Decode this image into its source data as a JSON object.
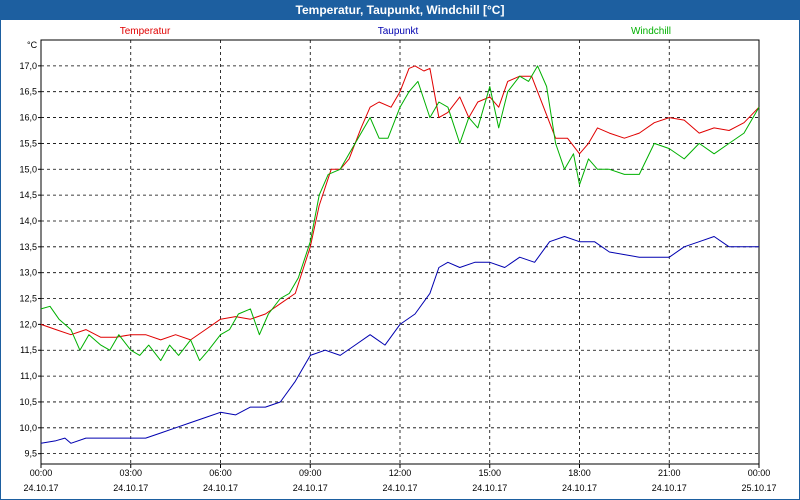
{
  "window": {
    "title": "Temperatur, Taupunkt, Windchill [°C]"
  },
  "chart_data": {
    "type": "line",
    "title": "Temperatur, Taupunkt, Windchill [°C]",
    "ylabel": "°C",
    "ylim": [
      9.3,
      17.5
    ],
    "y_ticks": [
      "9,5",
      "10,0",
      "10,5",
      "11,0",
      "11,5",
      "12,0",
      "12,5",
      "13,0",
      "13,5",
      "14,0",
      "14,5",
      "15,0",
      "15,5",
      "16,0",
      "16,5",
      "17,0"
    ],
    "x_ticks": [
      {
        "time": "00:00",
        "date": "24.10.17"
      },
      {
        "time": "03:00",
        "date": "24.10.17"
      },
      {
        "time": "06:00",
        "date": "24.10.17"
      },
      {
        "time": "09:00",
        "date": "24.10.17"
      },
      {
        "time": "12:00",
        "date": "24.10.17"
      },
      {
        "time": "15:00",
        "date": "24.10.17"
      },
      {
        "time": "18:00",
        "date": "24.10.17"
      },
      {
        "time": "21:00",
        "date": "24.10.17"
      },
      {
        "time": "00:00",
        "date": "25.10.17"
      }
    ],
    "xlim_hours": [
      0,
      24
    ],
    "grid": true,
    "series": [
      {
        "name": "Temperatur",
        "color": "#e00000",
        "x": [
          0,
          0.5,
          1,
          1.5,
          2,
          2.5,
          3,
          3.5,
          4,
          4.5,
          5,
          5.5,
          6,
          6.5,
          7,
          7.5,
          8,
          8.5,
          9,
          9.3,
          9.7,
          10,
          10.3,
          10.7,
          11,
          11.3,
          11.7,
          12,
          12.3,
          12.5,
          12.8,
          13,
          13.3,
          13.6,
          14,
          14.3,
          14.6,
          15,
          15.3,
          15.6,
          16,
          16.4,
          16.8,
          17.2,
          17.6,
          18,
          18.3,
          18.6,
          19,
          19.5,
          20,
          20.5,
          21,
          21.5,
          22,
          22.5,
          23,
          23.5,
          24
        ],
        "values": [
          12.0,
          11.9,
          11.8,
          11.9,
          11.75,
          11.75,
          11.8,
          11.8,
          11.7,
          11.8,
          11.7,
          11.9,
          12.1,
          12.15,
          12.1,
          12.2,
          12.4,
          12.6,
          13.5,
          14.3,
          15.0,
          15.0,
          15.2,
          15.8,
          16.2,
          16.3,
          16.2,
          16.5,
          16.95,
          17.0,
          16.9,
          16.95,
          16.0,
          16.1,
          16.4,
          16.0,
          16.3,
          16.4,
          16.2,
          16.7,
          16.8,
          16.8,
          16.2,
          15.6,
          15.6,
          15.3,
          15.5,
          15.8,
          15.7,
          15.6,
          15.7,
          15.9,
          16.0,
          15.95,
          15.7,
          15.8,
          15.75,
          15.9,
          16.2
        ]
      },
      {
        "name": "Taupunkt",
        "color": "#0000b0",
        "x": [
          0,
          0.5,
          0.8,
          1,
          1.5,
          2,
          2.5,
          3,
          3.5,
          4,
          4.5,
          5,
          5.5,
          6,
          6.5,
          7,
          7.5,
          8,
          8.5,
          9,
          9.5,
          10,
          10.5,
          11,
          11.5,
          12,
          12.5,
          13,
          13.3,
          13.6,
          14,
          14.5,
          15,
          15.5,
          16,
          16.5,
          17,
          17.5,
          18,
          18.5,
          19,
          19.5,
          20,
          20.5,
          21,
          21.5,
          22,
          22.5,
          23,
          23.5,
          24
        ],
        "values": [
          9.7,
          9.75,
          9.8,
          9.7,
          9.8,
          9.8,
          9.8,
          9.8,
          9.8,
          9.9,
          10.0,
          10.1,
          10.2,
          10.3,
          10.25,
          10.4,
          10.4,
          10.5,
          10.9,
          11.4,
          11.5,
          11.4,
          11.6,
          11.8,
          11.6,
          12.0,
          12.2,
          12.6,
          13.1,
          13.2,
          13.1,
          13.2,
          13.2,
          13.1,
          13.3,
          13.2,
          13.6,
          13.7,
          13.6,
          13.6,
          13.4,
          13.35,
          13.3,
          13.3,
          13.3,
          13.5,
          13.6,
          13.7,
          13.5,
          13.5,
          13.5
        ]
      },
      {
        "name": "Windchill",
        "color": "#00b000",
        "x": [
          0,
          0.3,
          0.6,
          1,
          1.3,
          1.6,
          2,
          2.3,
          2.6,
          3,
          3.3,
          3.6,
          4,
          4.3,
          4.6,
          5,
          5.3,
          5.6,
          6,
          6.3,
          6.6,
          7,
          7.3,
          7.6,
          8,
          8.3,
          8.6,
          9,
          9.3,
          9.6,
          10,
          10.3,
          10.6,
          11,
          11.3,
          11.6,
          12,
          12.3,
          12.6,
          13,
          13.3,
          13.6,
          14,
          14.3,
          14.6,
          15,
          15.3,
          15.6,
          16,
          16.3,
          16.6,
          16.9,
          17.2,
          17.5,
          17.8,
          18,
          18.3,
          18.6,
          19,
          19.5,
          20,
          20.5,
          21,
          21.5,
          22,
          22.5,
          23,
          23.5,
          24
        ],
        "values": [
          12.3,
          12.35,
          12.1,
          11.9,
          11.5,
          11.8,
          11.6,
          11.5,
          11.8,
          11.5,
          11.4,
          11.6,
          11.3,
          11.6,
          11.4,
          11.7,
          11.3,
          11.5,
          11.8,
          11.9,
          12.2,
          12.3,
          11.8,
          12.2,
          12.5,
          12.6,
          12.9,
          13.6,
          14.5,
          14.9,
          15.0,
          15.3,
          15.6,
          16.0,
          15.6,
          15.6,
          16.2,
          16.5,
          16.7,
          16.0,
          16.3,
          16.2,
          15.5,
          16.0,
          15.8,
          16.6,
          15.8,
          16.5,
          16.8,
          16.7,
          17.0,
          16.6,
          15.5,
          15.0,
          15.3,
          14.7,
          15.2,
          15.0,
          15.0,
          14.9,
          14.9,
          15.5,
          15.4,
          15.2,
          15.5,
          15.3,
          15.5,
          15.7,
          16.2
        ]
      }
    ]
  }
}
